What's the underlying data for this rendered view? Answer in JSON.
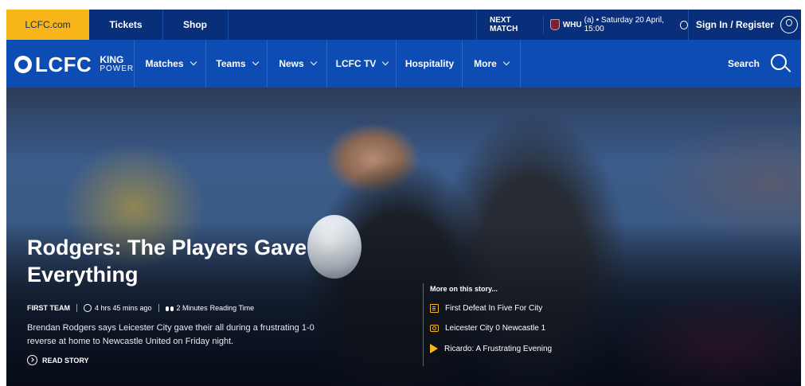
{
  "topbar": {
    "site_link": "LCFC.com",
    "tickets": "Tickets",
    "shop": "Shop",
    "next_match_label": "NEXT MATCH",
    "next_match_team": "WHU",
    "next_match_detail": "(a) • Saturday 20 April, 15:00",
    "sign_in": "Sign In / Register"
  },
  "nav": {
    "logo_word": "LCFC",
    "sponsor_line1": "KING",
    "sponsor_line2": "POWER",
    "items": [
      {
        "label": "Matches",
        "dropdown": true
      },
      {
        "label": "Teams",
        "dropdown": true
      },
      {
        "label": "News",
        "dropdown": true
      },
      {
        "label": "LCFC TV",
        "dropdown": true
      },
      {
        "label": "Hospitality",
        "dropdown": false
      },
      {
        "label": "More",
        "dropdown": true
      }
    ],
    "search_label": "Search"
  },
  "hero": {
    "headline": "Rodgers: The Players Gave Everything",
    "category": "FIRST TEAM",
    "time_ago": "4 hrs 45 mins ago",
    "read_time": "2 Minutes",
    "read_time_suffix": "Reading Time",
    "summary": "Brendan Rodgers says Leicester City gave their all during a frustrating 1-0 reverse at home to Newcastle United on Friday night.",
    "cta": "READ STORY"
  },
  "more_on_story": {
    "heading": "More on this story...",
    "items": [
      {
        "label": "First Defeat In Five For City",
        "icon": "article-icon"
      },
      {
        "label": "Leicester City 0 Newcastle 1",
        "icon": "camera-icon"
      },
      {
        "label": "Ricardo: A Frustrating Evening",
        "icon": "play-icon"
      }
    ]
  },
  "colors": {
    "brand_blue": "#0d4cb3",
    "dark_blue": "#0a2f7a",
    "gold": "#f7b51a"
  }
}
